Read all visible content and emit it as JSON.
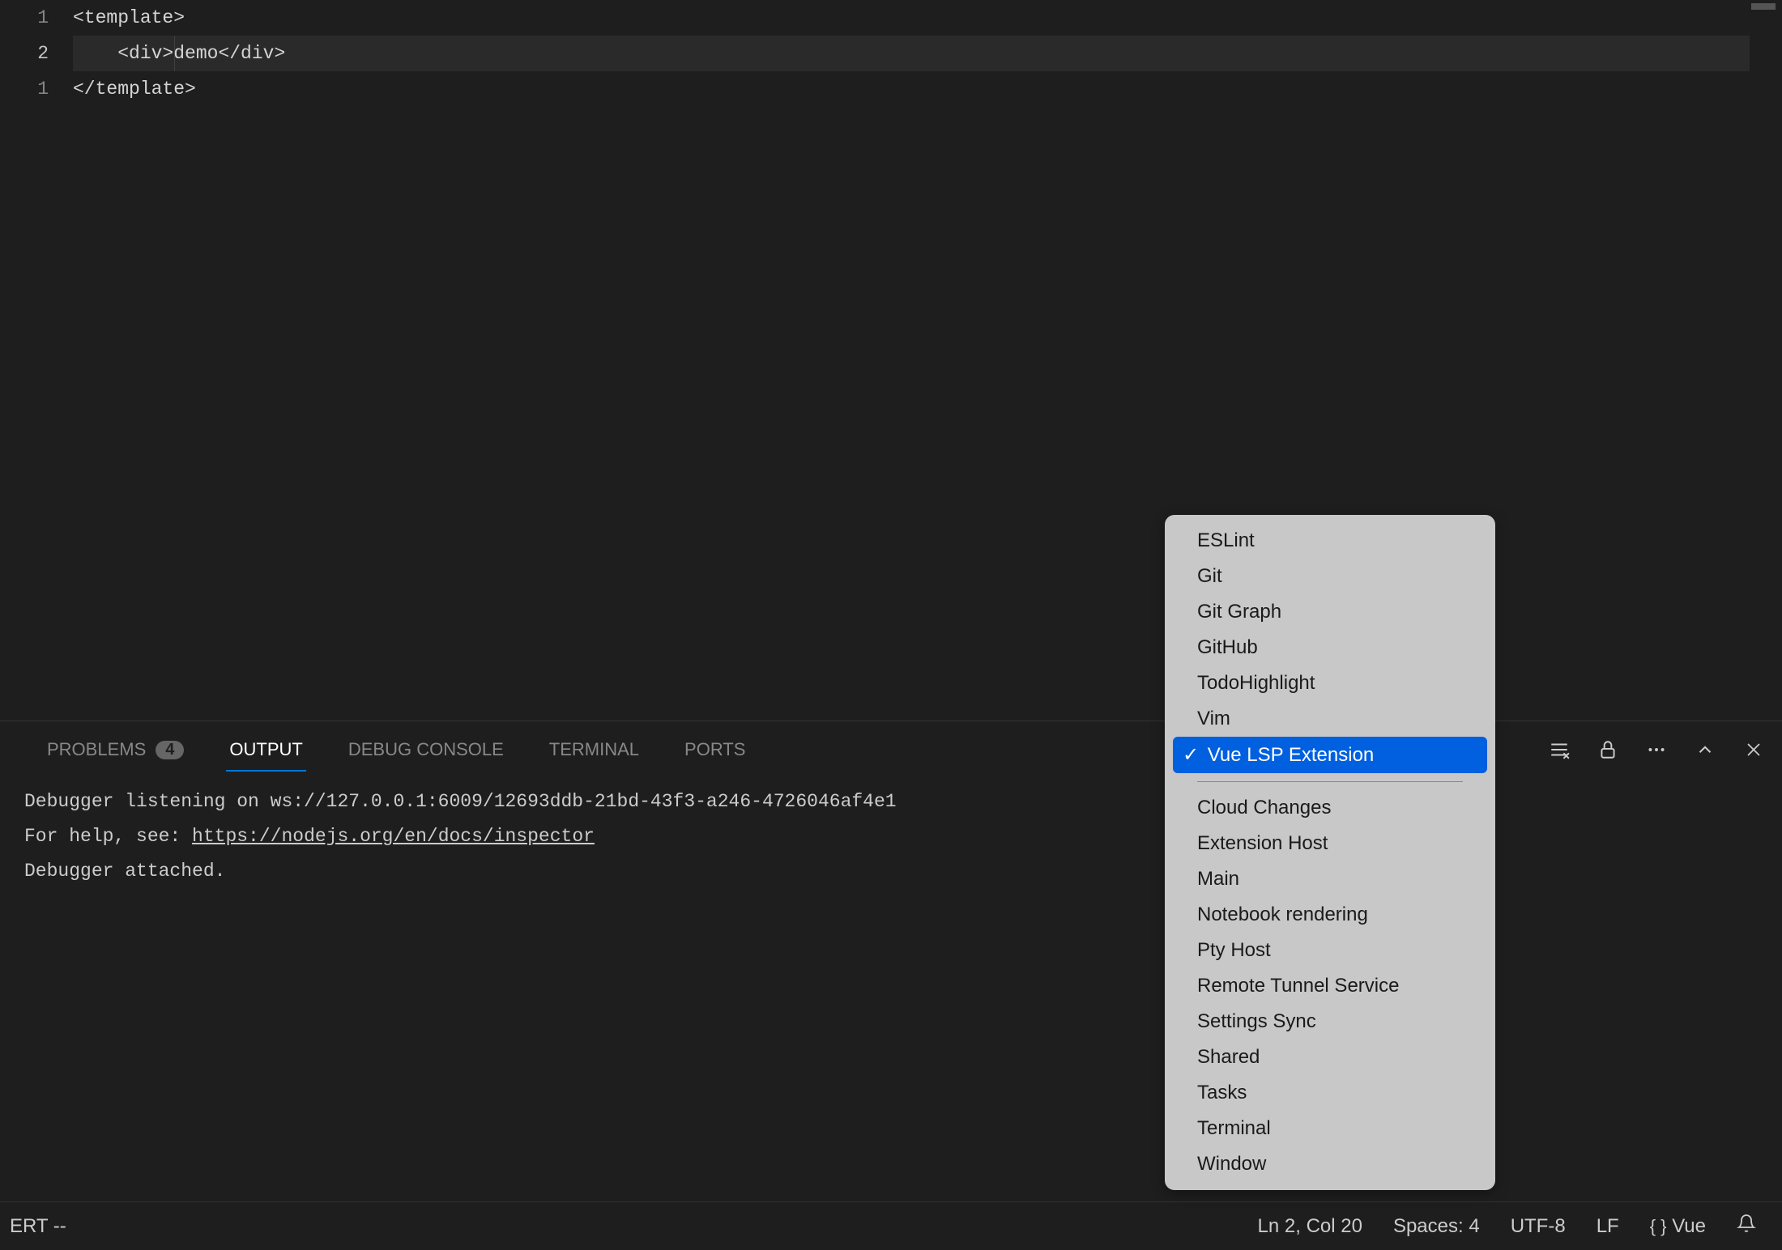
{
  "editor": {
    "lines": [
      {
        "num": "1",
        "text": "<template>"
      },
      {
        "num": "2",
        "text": "    <div>demo</div>"
      },
      {
        "num": "1",
        "text": "</template>"
      }
    ]
  },
  "panel": {
    "tabs": {
      "problems": "PROBLEMS",
      "problems_count": "4",
      "output": "OUTPUT",
      "debug_console": "DEBUG CONSOLE",
      "terminal": "TERMINAL",
      "ports": "PORTS"
    },
    "output_line1": "Debugger listening on ws://127.0.0.1:6009/12693ddb-21bd-43f3-a246-4726046af4e1",
    "output_line2_prefix": "For help, see: ",
    "output_line2_link": "https://nodejs.org/en/docs/inspector",
    "output_line3": "Debugger attached."
  },
  "dropdown": {
    "items_top": [
      "ESLint",
      "Git",
      "Git Graph",
      "GitHub",
      "TodoHighlight",
      "Vim"
    ],
    "selected": "Vue LSP Extension",
    "items_bottom": [
      "Cloud Changes",
      "Extension Host",
      "Main",
      "Notebook rendering",
      "Pty Host",
      "Remote Tunnel Service",
      "Settings Sync",
      "Shared",
      "Tasks",
      "Terminal",
      "Window"
    ]
  },
  "statusbar": {
    "mode": "ERT --",
    "position": "Ln 2, Col 20",
    "spaces": "Spaces: 4",
    "encoding": "UTF-8",
    "eol": "LF",
    "language": "Vue"
  }
}
